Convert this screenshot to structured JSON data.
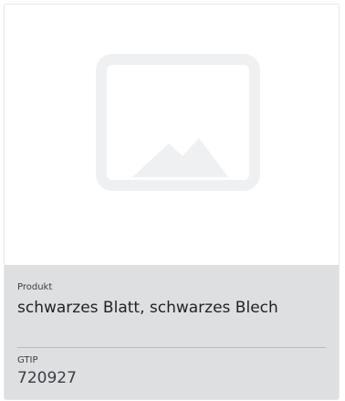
{
  "card": {
    "image": {
      "icon": "image-placeholder-icon",
      "colors": {
        "frame": "#eef0f2",
        "mountains": "#eef0f2"
      }
    },
    "product": {
      "label": "Produkt",
      "value": "schwarzes Blatt, schwarzes Blech"
    },
    "gtip": {
      "label": "GTIP",
      "value": "720927"
    }
  },
  "colors": {
    "panel_background": "#dddfe1",
    "card_border": "#e6e7e9",
    "divider": "#b7babe",
    "text_primary": "#1e2226",
    "text_secondary": "#3a3f45"
  }
}
